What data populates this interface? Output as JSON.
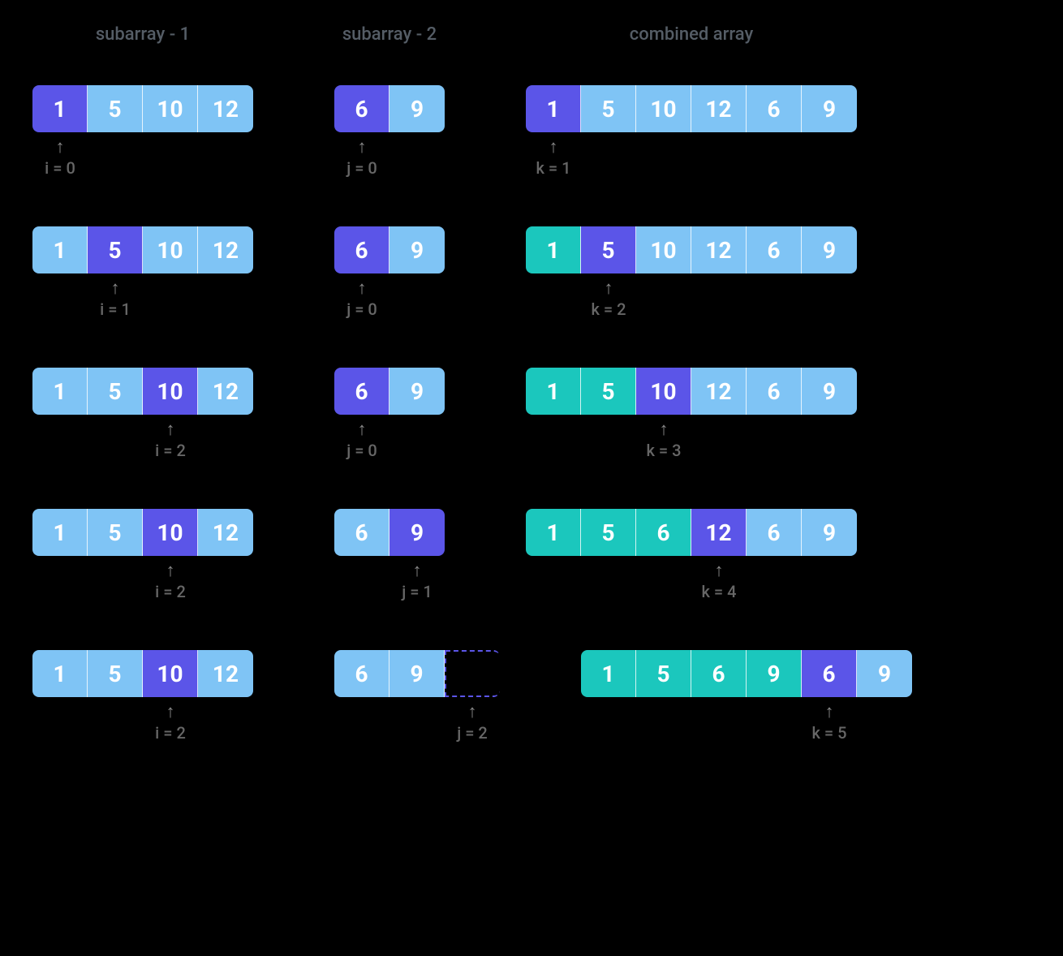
{
  "headers": {
    "h1": "subarray - 1",
    "h2": "subarray - 2",
    "h3": "combined array"
  },
  "arrow_glyph": "↑",
  "steps": [
    {
      "sub1": {
        "cells": [
          {
            "v": "1",
            "s": "highlight"
          },
          {
            "v": "5",
            "s": "normal"
          },
          {
            "v": "10",
            "s": "normal"
          },
          {
            "v": "12",
            "s": "normal"
          }
        ],
        "pointer_idx": 0,
        "pointer_label": "i = 0"
      },
      "sub2": {
        "cells": [
          {
            "v": "6",
            "s": "highlight"
          },
          {
            "v": "9",
            "s": "normal"
          }
        ],
        "pointer_idx": 0,
        "pointer_label": "j = 0"
      },
      "combined": {
        "cells": [
          {
            "v": "1",
            "s": "highlight"
          },
          {
            "v": "5",
            "s": "normal"
          },
          {
            "v": "10",
            "s": "normal"
          },
          {
            "v": "12",
            "s": "normal"
          },
          {
            "v": "6",
            "s": "normal"
          },
          {
            "v": "9",
            "s": "normal"
          }
        ],
        "pointer_idx": 0,
        "pointer_label": "k = 1"
      }
    },
    {
      "sub1": {
        "cells": [
          {
            "v": "1",
            "s": "normal"
          },
          {
            "v": "5",
            "s": "highlight"
          },
          {
            "v": "10",
            "s": "normal"
          },
          {
            "v": "12",
            "s": "normal"
          }
        ],
        "pointer_idx": 1,
        "pointer_label": "i = 1"
      },
      "sub2": {
        "cells": [
          {
            "v": "6",
            "s": "highlight"
          },
          {
            "v": "9",
            "s": "normal"
          }
        ],
        "pointer_idx": 0,
        "pointer_label": "j = 0"
      },
      "combined": {
        "cells": [
          {
            "v": "1",
            "s": "done"
          },
          {
            "v": "5",
            "s": "highlight"
          },
          {
            "v": "10",
            "s": "normal"
          },
          {
            "v": "12",
            "s": "normal"
          },
          {
            "v": "6",
            "s": "normal"
          },
          {
            "v": "9",
            "s": "normal"
          }
        ],
        "pointer_idx": 1,
        "pointer_label": "k = 2"
      }
    },
    {
      "sub1": {
        "cells": [
          {
            "v": "1",
            "s": "normal"
          },
          {
            "v": "5",
            "s": "normal"
          },
          {
            "v": "10",
            "s": "highlight"
          },
          {
            "v": "12",
            "s": "normal"
          }
        ],
        "pointer_idx": 2,
        "pointer_label": "i = 2"
      },
      "sub2": {
        "cells": [
          {
            "v": "6",
            "s": "highlight"
          },
          {
            "v": "9",
            "s": "normal"
          }
        ],
        "pointer_idx": 0,
        "pointer_label": "j = 0"
      },
      "combined": {
        "cells": [
          {
            "v": "1",
            "s": "done"
          },
          {
            "v": "5",
            "s": "done"
          },
          {
            "v": "10",
            "s": "highlight"
          },
          {
            "v": "12",
            "s": "normal"
          },
          {
            "v": "6",
            "s": "normal"
          },
          {
            "v": "9",
            "s": "normal"
          }
        ],
        "pointer_idx": 2,
        "pointer_label": "k = 3"
      }
    },
    {
      "sub1": {
        "cells": [
          {
            "v": "1",
            "s": "normal"
          },
          {
            "v": "5",
            "s": "normal"
          },
          {
            "v": "10",
            "s": "highlight"
          },
          {
            "v": "12",
            "s": "normal"
          }
        ],
        "pointer_idx": 2,
        "pointer_label": "i = 2"
      },
      "sub2": {
        "cells": [
          {
            "v": "6",
            "s": "normal"
          },
          {
            "v": "9",
            "s": "highlight"
          }
        ],
        "pointer_idx": 1,
        "pointer_label": "j = 1"
      },
      "combined": {
        "cells": [
          {
            "v": "1",
            "s": "done"
          },
          {
            "v": "5",
            "s": "done"
          },
          {
            "v": "6",
            "s": "done"
          },
          {
            "v": "12",
            "s": "highlight"
          },
          {
            "v": "6",
            "s": "normal"
          },
          {
            "v": "9",
            "s": "normal"
          }
        ],
        "pointer_idx": 3,
        "pointer_label": "k = 4"
      }
    },
    {
      "sub1": {
        "cells": [
          {
            "v": "1",
            "s": "normal"
          },
          {
            "v": "5",
            "s": "normal"
          },
          {
            "v": "10",
            "s": "highlight"
          },
          {
            "v": "12",
            "s": "normal"
          }
        ],
        "pointer_idx": 2,
        "pointer_label": "i = 2"
      },
      "sub2": {
        "cells": [
          {
            "v": "6",
            "s": "normal"
          },
          {
            "v": "9",
            "s": "normal"
          },
          {
            "v": "",
            "s": "empty"
          }
        ],
        "pointer_idx": 2,
        "pointer_label": "j = 2"
      },
      "combined": {
        "cells": [
          {
            "v": "1",
            "s": "done"
          },
          {
            "v": "5",
            "s": "done"
          },
          {
            "v": "6",
            "s": "done"
          },
          {
            "v": "9",
            "s": "done"
          },
          {
            "v": "6",
            "s": "highlight"
          },
          {
            "v": "9",
            "s": "normal"
          }
        ],
        "pointer_idx": 4,
        "pointer_label": "k = 5"
      }
    }
  ]
}
